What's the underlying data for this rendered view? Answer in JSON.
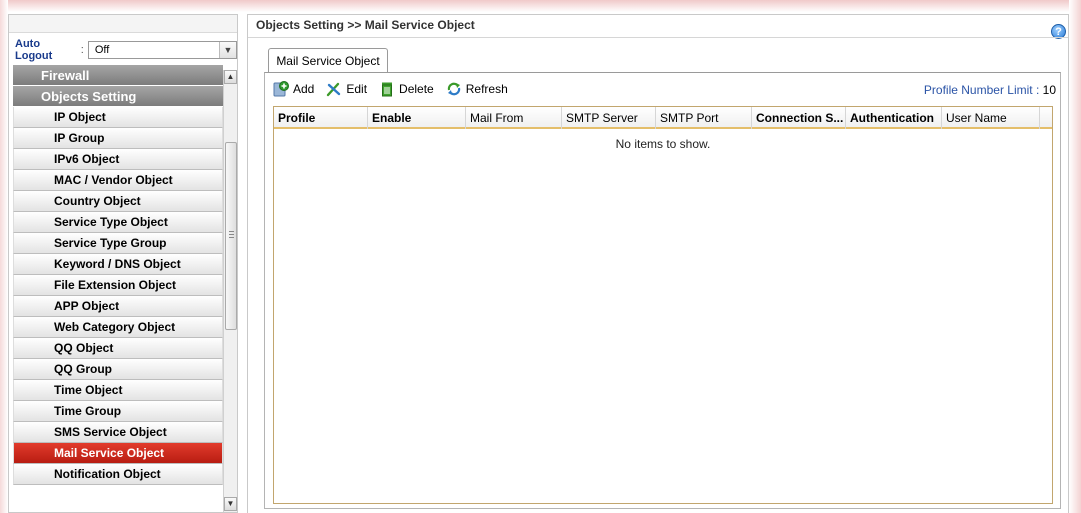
{
  "sidebar": {
    "auto_logout_label": "Auto Logout",
    "auto_logout_sep": ":",
    "auto_logout_value": "Off",
    "sections": [
      "Firewall",
      "Objects Setting"
    ],
    "items": [
      {
        "label": "IP Object"
      },
      {
        "label": "IP Group"
      },
      {
        "label": "IPv6 Object"
      },
      {
        "label": "MAC / Vendor Object"
      },
      {
        "label": "Country Object"
      },
      {
        "label": "Service Type Object"
      },
      {
        "label": "Service Type Group"
      },
      {
        "label": "Keyword / DNS Object"
      },
      {
        "label": "File Extension Object"
      },
      {
        "label": "APP Object"
      },
      {
        "label": "Web Category Object"
      },
      {
        "label": "QQ Object"
      },
      {
        "label": "QQ Group"
      },
      {
        "label": "Time Object"
      },
      {
        "label": "Time Group"
      },
      {
        "label": "SMS Service Object"
      },
      {
        "label": "Mail Service Object"
      },
      {
        "label": "Notification Object"
      }
    ],
    "active_item": "Mail Service Object",
    "active_color": "#c8281d"
  },
  "main": {
    "breadcrumb": "Objects Setting >> Mail Service Object",
    "help_icon": "?",
    "tab_label": "Mail Service Object",
    "toolbar": {
      "add_label": "Add",
      "edit_label": "Edit",
      "delete_label": "Delete",
      "refresh_label": "Refresh"
    },
    "limit_label": "Profile Number Limit :",
    "limit_value": "10",
    "columns": [
      "Profile",
      "Enable",
      "Mail From",
      "SMTP Server",
      "SMTP Port",
      "Connection S...",
      "Authentication",
      "User Name"
    ],
    "empty_text": "No items to show."
  }
}
